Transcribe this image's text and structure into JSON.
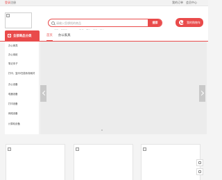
{
  "topbar": {
    "login": "登录",
    "register": "注册",
    "my_orders": "我的订单",
    "member_center": "会员中心"
  },
  "search": {
    "placeholder": "请输入您想找的商品",
    "button": "搜索",
    "hot_words": [
      "打印",
      "复印机",
      "Lenovo",
      "联想",
      "理光",
      "复印",
      "兄弟"
    ]
  },
  "cart": {
    "label": "我的购物车"
  },
  "nav": {
    "all_categories": "全部商品分类",
    "tabs": [
      "首页",
      "办公家具"
    ]
  },
  "categories": [
    "办公家具",
    "办公用纸",
    "笔记本子",
    "打印、复印/扫描传真耗材",
    "办公设备",
    "电器设备",
    "打印设备",
    "网络设备",
    "计算机设备"
  ],
  "colors": {
    "accent": "#e94b4b"
  },
  "icons": {
    "search": "search-icon",
    "cart": "cart-icon",
    "categories": "grid-icon"
  }
}
